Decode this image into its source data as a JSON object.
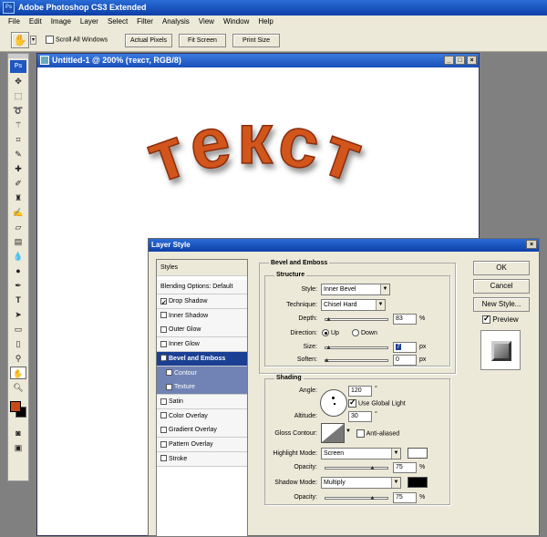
{
  "app": {
    "title": "Adobe Photoshop CS3 Extended",
    "icon": "Ps"
  },
  "menu": [
    "File",
    "Edit",
    "Image",
    "Layer",
    "Select",
    "Filter",
    "Analysis",
    "View",
    "Window",
    "Help"
  ],
  "options": {
    "hand_icon": "hand-icon",
    "scroll_all_label": "Scroll All Windows",
    "actual_pixels": "Actual Pixels",
    "fit_screen": "Fit Screen",
    "print_size": "Print Size"
  },
  "toolbox": {
    "logo": "Ps",
    "foreground_color": "#c84a18",
    "background_color": "#000000"
  },
  "document": {
    "title": "Untitled-1 @ 200% (текст, RGB/8)",
    "art_text": "текст",
    "art_color": "#d2541e"
  },
  "dialog": {
    "title": "Layer Style",
    "styles_header": "Styles",
    "blending": "Blending Options: Default",
    "items": [
      {
        "label": "Drop Shadow",
        "checked": true
      },
      {
        "label": "Inner Shadow",
        "checked": false
      },
      {
        "label": "Outer Glow",
        "checked": false
      },
      {
        "label": "Inner Glow",
        "checked": false
      },
      {
        "label": "Bevel and Emboss",
        "checked": true
      },
      {
        "label": "Contour",
        "checked": false
      },
      {
        "label": "Texture",
        "checked": false
      },
      {
        "label": "Satin",
        "checked": false
      },
      {
        "label": "Color Overlay",
        "checked": false
      },
      {
        "label": "Gradient Overlay",
        "checked": false
      },
      {
        "label": "Pattern Overlay",
        "checked": false
      },
      {
        "label": "Stroke",
        "checked": false
      }
    ],
    "bevel": {
      "section": "Bevel and Emboss",
      "structure": "Structure",
      "style_label": "Style:",
      "style_value": "Inner Bevel",
      "technique_label": "Technique:",
      "technique_value": "Chisel Hard",
      "depth_label": "Depth:",
      "depth_value": "83",
      "depth_unit": "%",
      "direction_label": "Direction:",
      "dir_up": "Up",
      "dir_down": "Down",
      "size_label": "Size:",
      "size_value": "7",
      "size_unit": "px",
      "soften_label": "Soften:",
      "soften_value": "0",
      "soften_unit": "px"
    },
    "shading": {
      "section": "Shading",
      "angle_label": "Angle:",
      "angle_value": "120",
      "angle_unit": "°",
      "global_light": "Use Global Light",
      "altitude_label": "Altitude:",
      "altitude_value": "30",
      "altitude_unit": "°",
      "gloss_label": "Gloss Contour:",
      "anti_aliased": "Anti-aliased",
      "highlight_label": "Highlight Mode:",
      "highlight_value": "Screen",
      "highlight_color": "#ffffff",
      "opacity_label": "Opacity:",
      "hl_opacity": "75",
      "hl_unit": "%",
      "shadow_label": "Shadow Mode:",
      "shadow_value": "Multiply",
      "shadow_color": "#000000",
      "opacity2_label": "Opacity:",
      "sh_opacity": "75",
      "sh_unit": "%"
    },
    "buttons": {
      "ok": "OK",
      "cancel": "Cancel",
      "new_style": "New Style...",
      "preview": "Preview"
    }
  }
}
